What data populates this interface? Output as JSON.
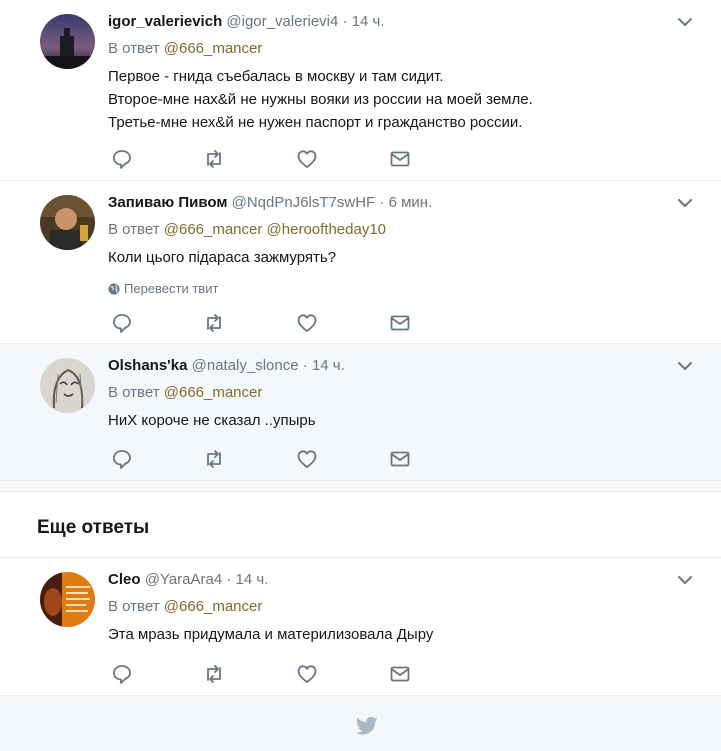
{
  "tweets": [
    {
      "name": "igor_valerievich",
      "handle": "@igor_valerievi4",
      "dot": "·",
      "time": "14 ч.",
      "reply_prefix": "В ответ",
      "reply_mentions": "@666_mancer",
      "lines": [
        "Первое - гнида съебалась в москву и там сидит.",
        "Второе-мне нах&й не нужны вояки из россии на моей земле.",
        "Третье-мне нех&й не нужен паспорт и гражданство россии."
      ]
    },
    {
      "name": "Запиваю Пивом",
      "handle": "@NqdPnJ6lsT7swHF",
      "dot": "·",
      "time": "6 мин.",
      "reply_prefix": "В ответ",
      "reply_mentions": "@666_mancer @herooftheday10",
      "lines": [
        "Коли цього підараса зажмурять?"
      ],
      "translate": "Перевести твит"
    },
    {
      "name": "Olshans'ka",
      "handle": "@nataly_slonce",
      "dot": "·",
      "time": "14 ч.",
      "reply_prefix": "В ответ",
      "reply_mentions": "@666_mancer",
      "lines": [
        "НиХ короче не сказал ..упырь"
      ]
    },
    {
      "name": "Cleo",
      "handle": "@YaraAra4",
      "dot": "·",
      "time": "14 ч.",
      "reply_prefix": "В ответ",
      "reply_mentions": "@666_mancer",
      "lines": [
        "Эта мразь придумала и материлизовала Дыру"
      ]
    }
  ],
  "more_replies_title": "Еще ответы",
  "icons": {
    "reply": "reply-icon",
    "retweet": "retweet-icon",
    "like": "like-icon",
    "dm": "direct-message-icon",
    "more": "chevron-down-icon",
    "globe": "globe-icon",
    "footer": "twitter-bird-icon"
  },
  "colors": {
    "icon_gray": "#657786",
    "mention": "#826a2e",
    "highlight_bg": "#f5f8fa",
    "border": "#e6ecf0"
  }
}
